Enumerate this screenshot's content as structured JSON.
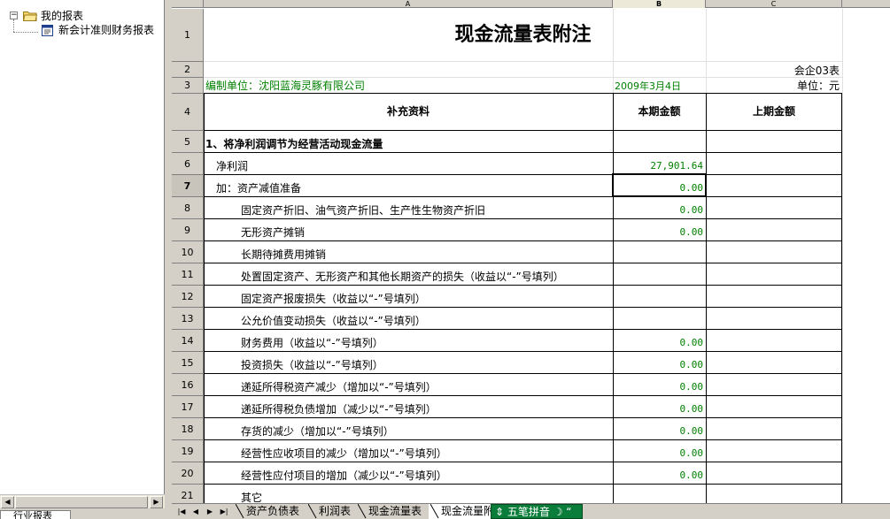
{
  "tree": {
    "root_label": "我的报表",
    "child_label": "新会计准则财务报表",
    "expander": "−",
    "bottom_tab": "行业报表"
  },
  "columns": {
    "a": "A",
    "b": "B",
    "c": "C"
  },
  "sheet": {
    "title": "现金流量表附注",
    "form_code": "会企03表",
    "company": "编制单位：沈阳蓝海灵豚有限公司",
    "date": "2009年3月4日",
    "unit": "单位：元",
    "headers": {
      "item": "补充资料",
      "current": "本期金额",
      "previous": "上期金额"
    },
    "row_numbers": [
      "1",
      "2",
      "3",
      "4",
      "5",
      "6",
      "7",
      "8",
      "9",
      "10",
      "11",
      "12",
      "13",
      "14",
      "15",
      "16",
      "17",
      "18",
      "19",
      "20",
      "21"
    ],
    "rows": [
      {
        "label": "1、将净利润调节为经营活动现金流量",
        "current": "",
        "previous": ""
      },
      {
        "label": "净利润",
        "current": "27,901.64",
        "previous": ""
      },
      {
        "label": "加：资产减值准备",
        "current": "0.00",
        "previous": ""
      },
      {
        "label": "固定资产折旧、油气资产折旧、生产性生物资产折旧",
        "current": "0.00",
        "previous": ""
      },
      {
        "label": "无形资产摊销",
        "current": "0.00",
        "previous": ""
      },
      {
        "label": "长期待摊费用摊销",
        "current": "",
        "previous": ""
      },
      {
        "label": "处置固定资产、无形资产和其他长期资产的损失（收益以“-”号填列）",
        "current": "",
        "previous": ""
      },
      {
        "label": "固定资产报废损失（收益以“-”号填列）",
        "current": "",
        "previous": ""
      },
      {
        "label": "公允价值变动损失（收益以“-”号填列）",
        "current": "",
        "previous": ""
      },
      {
        "label": "财务费用（收益以“-”号填列）",
        "current": "0.00",
        "previous": ""
      },
      {
        "label": "投资损失（收益以“-”号填列）",
        "current": "0.00",
        "previous": ""
      },
      {
        "label": "递延所得税资产减少（增加以“-”号填列）",
        "current": "0.00",
        "previous": ""
      },
      {
        "label": "递延所得税负债增加（减少以“-”号填列）",
        "current": "0.00",
        "previous": ""
      },
      {
        "label": "存货的减少（增加以“-”号填列）",
        "current": "0.00",
        "previous": ""
      },
      {
        "label": "经营性应收项目的减少（增加以“-”号填列）",
        "current": "0.00",
        "previous": ""
      },
      {
        "label": "经营性应付项目的增加（减少以“-”号填列）",
        "current": "0.00",
        "previous": ""
      },
      {
        "label": "其它",
        "current": "",
        "previous": ""
      }
    ]
  },
  "tabs": [
    "资产负债表",
    "利润表",
    "现金流量表",
    "现金流量附"
  ],
  "active_tab_index": 3,
  "ime": {
    "label": "五笔拼音"
  },
  "colors": {
    "green_text": "#008000",
    "ime_bg": "#0b7d3a",
    "selected_row_header": "#c8c4bc"
  }
}
